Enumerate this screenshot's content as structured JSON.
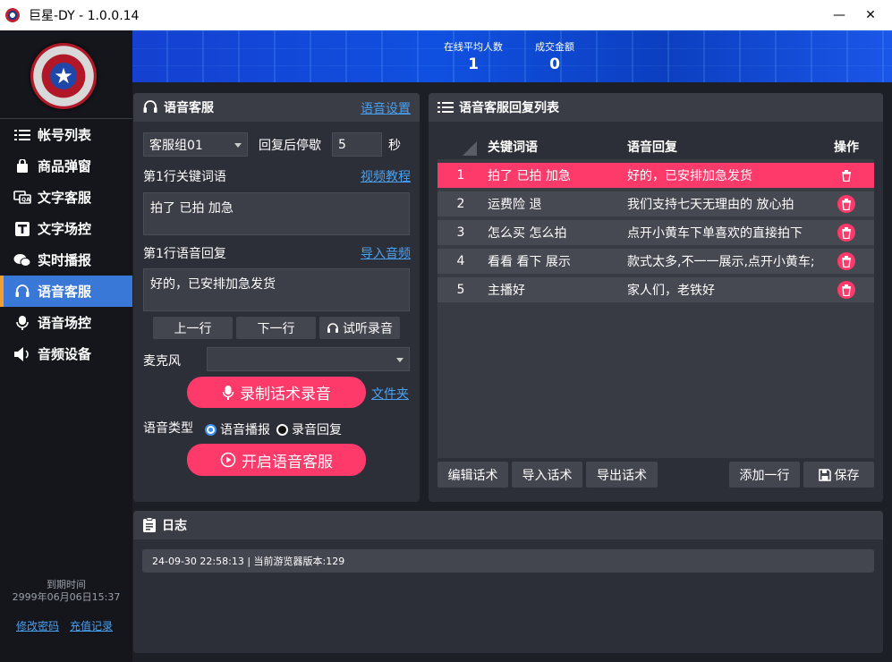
{
  "window": {
    "title": "巨星-DY - 1.0.0.14",
    "minimize": "—",
    "close": "✕"
  },
  "sidebar": {
    "items": [
      {
        "label": "帐号列表",
        "icon": "list-icon"
      },
      {
        "label": "商品弹窗",
        "icon": "shopping-bag-icon"
      },
      {
        "label": "文字客服",
        "icon": "chat-text-icon"
      },
      {
        "label": "文字场控",
        "icon": "text-t-icon"
      },
      {
        "label": "实时播报",
        "icon": "wechat-icon"
      },
      {
        "label": "语音客服",
        "icon": "headset-icon",
        "active": true
      },
      {
        "label": "语音场控",
        "icon": "microphone-icon"
      },
      {
        "label": "音频设备",
        "icon": "speaker-icon"
      }
    ],
    "expire_label": "到期时间",
    "expire_date": "2999年06月06日15:37",
    "change_password": "修改密码",
    "recharge_record": "充值记录"
  },
  "banner": {
    "stats": [
      {
        "label": "在线平均人数",
        "value": "1"
      },
      {
        "label": "成交金额",
        "value": "0"
      }
    ]
  },
  "voice_service": {
    "title": "语音客服",
    "settings_link": "语音设置",
    "group_select": "客服组01",
    "pause_label": "回复后停歇",
    "pause_value": "5",
    "pause_unit": "秒",
    "keyword_label": "第1行关键词语",
    "video_tutorial": "视频教程",
    "keyword_value": "拍了 已拍 加急",
    "reply_label": "第1行语音回复",
    "import_audio": "导入音频",
    "reply_value": "好的，已安排加急发货",
    "prev_row": "上一行",
    "next_row": "下一行",
    "preview_record": "试听录音",
    "mic_label": "麦克风",
    "mic_value": "",
    "record_button": "录制话术录音",
    "folder_link": "文件夹",
    "voice_type_label": "语音类型",
    "voice_type_options": [
      "语音播报",
      "录音回复"
    ],
    "start_button": "开启语音客服"
  },
  "reply_list": {
    "title": "语音客服回复列表",
    "columns": [
      "",
      "关键词语",
      "语音回复",
      "操作"
    ],
    "rows": [
      {
        "num": "1",
        "keyword": "拍了 已拍 加急",
        "reply": "好的，已安排加急发货",
        "selected": true
      },
      {
        "num": "2",
        "keyword": "运费险 退",
        "reply": "我们支持七天无理由的 放心拍"
      },
      {
        "num": "3",
        "keyword": "怎么买 怎么拍",
        "reply": "点开小黄车下单喜欢的直接拍下"
      },
      {
        "num": "4",
        "keyword": "看看 看下 展示",
        "reply": "款式太多,不一一展示,点开小黄车;"
      },
      {
        "num": "5",
        "keyword": "主播好",
        "reply": "家人们，老铁好"
      }
    ],
    "edit_script": "编辑话术",
    "import_script": "导入话术",
    "export_script": "导出话术",
    "add_row": "添加一行",
    "save": "保存"
  },
  "log": {
    "title": "日志",
    "lines": [
      "24-09-30 22:58:13 | 当前游览器版本:129"
    ]
  },
  "colors": {
    "accent_pink": "#fe3a6a",
    "active_blue": "#3a78d8",
    "link_blue": "#4aa0f0",
    "banner_blue": "#1050e0"
  }
}
